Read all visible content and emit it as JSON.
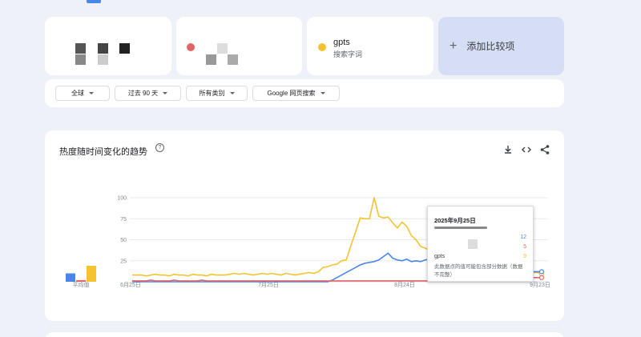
{
  "compare": {
    "term3": {
      "name": "gpts",
      "subtitle": "搜索字词",
      "color": "#f4c430"
    },
    "add_label": "添加比较项"
  },
  "filters": [
    "全球",
    "过去 90 天",
    "所有类别",
    "Google 网页搜索"
  ],
  "card": {
    "title": "热度随时间变化的趋势"
  },
  "colors": {
    "blue": "#4a86e8",
    "red": "#e06666",
    "yellow": "#f4c430",
    "add_bg": "#d6def5"
  },
  "icons": [
    "help-icon",
    "download-icon",
    "embed-icon",
    "share-icon"
  ],
  "tooltip": {
    "date": "2025年9月25日",
    "rows": [
      {
        "label": "",
        "value": "12",
        "color": "#4a86e8"
      },
      {
        "label": "",
        "value": "5",
        "color": "#e06666"
      },
      {
        "label": "gpts",
        "value": "9",
        "color": "#f4c430"
      }
    ],
    "note": "此数据点的值可能包含部分数据（数据不完整）"
  },
  "chart_data": {
    "type": "line",
    "average_label": "平均值",
    "averages": [
      {
        "series": "blue",
        "value": 10
      },
      {
        "series": "red",
        "value": 2
      },
      {
        "series": "yellow",
        "value": 19
      }
    ],
    "x_tick_labels": [
      "6月25日",
      "7月25日",
      "8月24日",
      "9月23日"
    ],
    "y_ticks": [
      25,
      50,
      75,
      100
    ],
    "ylim": [
      0,
      100
    ],
    "grid": true,
    "series": [
      {
        "color": "#f4c430",
        "values": [
          8,
          8,
          8,
          7,
          8,
          9,
          8,
          8,
          7,
          9,
          8,
          8,
          7,
          9,
          8,
          8,
          7,
          9,
          8,
          8,
          8,
          9,
          10,
          9,
          10,
          9,
          8,
          9,
          10,
          9,
          10,
          9,
          8,
          10,
          9,
          8,
          9,
          10,
          11,
          10,
          12,
          17,
          18,
          20,
          21,
          25,
          26,
          43,
          59,
          76,
          75,
          75,
          100,
          78,
          76,
          77,
          70,
          64,
          71,
          66,
          55,
          50,
          42,
          40,
          37,
          38,
          34,
          34,
          38,
          39,
          40,
          40,
          38,
          34,
          30,
          22,
          14,
          17,
          28,
          23,
          22,
          22,
          16,
          14,
          12,
          12,
          11,
          11,
          9
        ]
      },
      {
        "color": "#4a86e8",
        "values": [
          0,
          0,
          0,
          0,
          0,
          0,
          0,
          0,
          0,
          0,
          0,
          0,
          0,
          0,
          0,
          0,
          0,
          0,
          0,
          0,
          0,
          0,
          0,
          0,
          0,
          0,
          0,
          0,
          0,
          0,
          0,
          0,
          0,
          0,
          0,
          0,
          0,
          0,
          0,
          0,
          0,
          0,
          0,
          2,
          5,
          8,
          11,
          14,
          17,
          20,
          22,
          23,
          24,
          26,
          30,
          34,
          28,
          26,
          25,
          27,
          24,
          25,
          24,
          26,
          27,
          28,
          26,
          24,
          23,
          25,
          26,
          25,
          27,
          28,
          26,
          20,
          18,
          18,
          16,
          15,
          14,
          13,
          13,
          12,
          12,
          13,
          12,
          12,
          12
        ]
      },
      {
        "color": "#e06666",
        "values": [
          1,
          1,
          1,
          1,
          2,
          1,
          1,
          1,
          1,
          2,
          1,
          1,
          1,
          1,
          1,
          2,
          1,
          1,
          1,
          1,
          1,
          1,
          1,
          1,
          1,
          1,
          1,
          1,
          1,
          1,
          1,
          1,
          1,
          1,
          1,
          1,
          1,
          1,
          1,
          1,
          1,
          1,
          1,
          1,
          1,
          1,
          1,
          1,
          1,
          1,
          1,
          1,
          1,
          1,
          1,
          1,
          1,
          1,
          1,
          1,
          1,
          1,
          1,
          1,
          1,
          1,
          1,
          1,
          1,
          1,
          1,
          1,
          1,
          1,
          1,
          1,
          1,
          1,
          1,
          1,
          2,
          2,
          3,
          3,
          4,
          4,
          5,
          5,
          5
        ]
      }
    ]
  }
}
